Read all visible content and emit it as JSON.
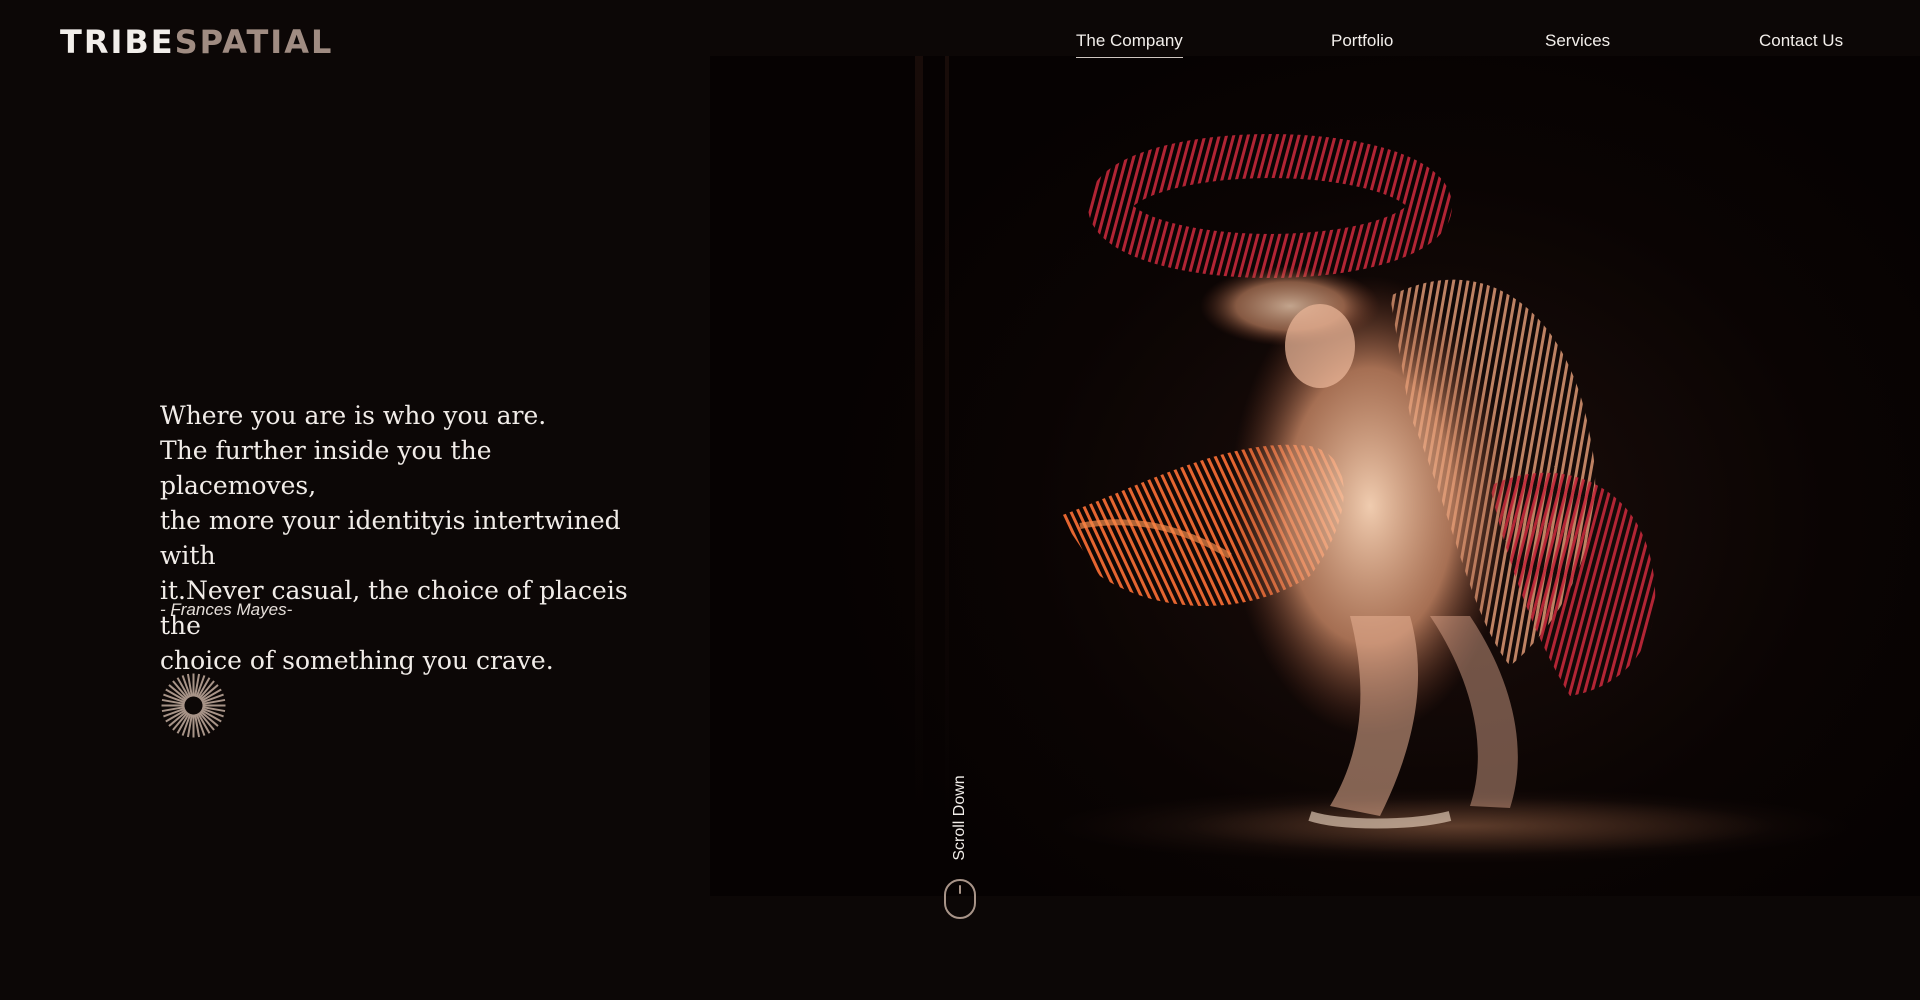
{
  "header": {
    "logo_part1": "TRIBE",
    "logo_part2": "SPATIAL",
    "nav": [
      {
        "label": "The Company",
        "active": true
      },
      {
        "label": "Portfolio"
      },
      {
        "label": "Services"
      },
      {
        "label": "Contact Us"
      }
    ]
  },
  "hero": {
    "quote_lines": [
      "Where you are is who you are.",
      "The further inside you the placemoves,",
      "the more your identityis intertwined with",
      "it.Never casual, the choice of placeis the",
      "choice of something you crave."
    ],
    "author": "- Frances Mayes-",
    "image_icon": "dancer-photo",
    "decor_icon": "sunburst-icon"
  },
  "scroll": {
    "label": "Scroll Down",
    "icon": "mouse-icon"
  },
  "colors": {
    "background": "#0c0706",
    "text": "#f2eeea",
    "logo_accent": "#a08c82",
    "icon_accent": "#a89488",
    "dancer_red": "#d8402a",
    "dancer_orange": "#f07a3c"
  }
}
